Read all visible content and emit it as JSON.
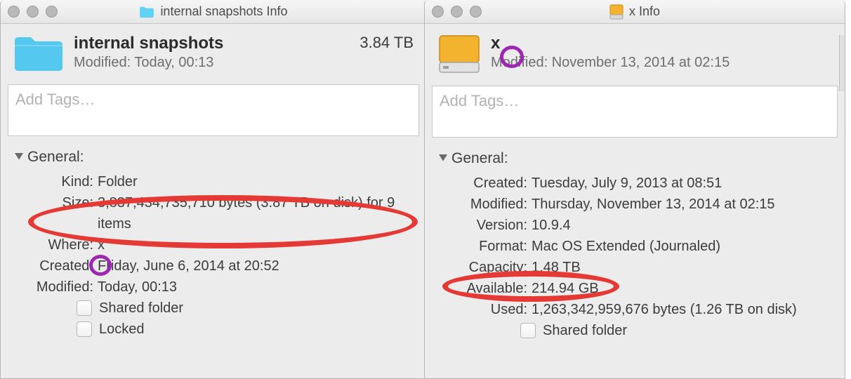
{
  "left": {
    "window_title": "internal snapshots Info",
    "item_name": "internal snapshots",
    "modified_header": "Modified: Today, 00:13",
    "size_header": "3.84 TB",
    "tags_placeholder": "Add Tags…",
    "general_label": "General:",
    "kind": {
      "k": "Kind:",
      "v": "Folder"
    },
    "size": {
      "k": "Size:",
      "v": "3,837,434,735,710 bytes (3.87 TB on disk) for 9 items"
    },
    "where": {
      "k": "Where:",
      "v": "x"
    },
    "created": {
      "k": "Created:",
      "v": "Friday, June 6, 2014 at 20:52"
    },
    "modified": {
      "k": "Modified:",
      "v": "Today, 00:13"
    },
    "shared_label": "Shared folder",
    "locked_label": "Locked"
  },
  "right": {
    "window_title": "x Info",
    "item_name": "x",
    "modified_header": "Modified: November 13, 2014 at 02:15",
    "tags_placeholder": "Add Tags…",
    "general_label": "General:",
    "created": {
      "k": "Created:",
      "v": "Tuesday, July 9, 2013 at 08:51"
    },
    "modified": {
      "k": "Modified:",
      "v": "Thursday, November 13, 2014 at 02:15"
    },
    "version": {
      "k": "Version:",
      "v": "10.9.4"
    },
    "format": {
      "k": "Format:",
      "v": "Mac OS Extended (Journaled)"
    },
    "capacity": {
      "k": "Capacity:",
      "v": "1.48 TB"
    },
    "available": {
      "k": "Available:",
      "v": "214.94 GB"
    },
    "used": {
      "k": "Used:",
      "v": "1,263,342,959,676 bytes (1.26 TB on disk)"
    },
    "shared_label": "Shared folder"
  }
}
